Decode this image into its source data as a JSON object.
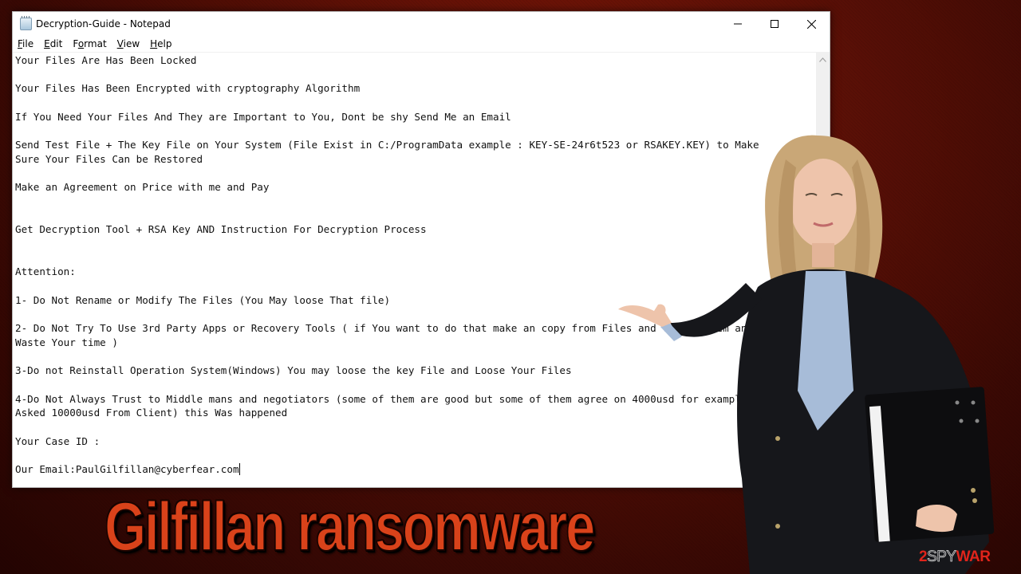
{
  "window": {
    "title": "Decryption-Guide - Notepad",
    "app_icon": "notepad-icon",
    "controls": {
      "minimize": "minimize-icon",
      "maximize": "maximize-icon",
      "close": "close-icon"
    }
  },
  "menubar": {
    "items": [
      {
        "label": "File",
        "accel": "F",
        "rest": "ile"
      },
      {
        "label": "Edit",
        "accel": "E",
        "rest": "dit"
      },
      {
        "label": "Format",
        "pre": "F",
        "accel": "o",
        "rest": "rmat"
      },
      {
        "label": "View",
        "accel": "V",
        "rest": "iew"
      },
      {
        "label": "Help",
        "accel": "H",
        "rest": "elp"
      }
    ]
  },
  "editor": {
    "lines": [
      "Your Files Are Has Been Locked",
      "",
      "Your Files Has Been Encrypted with cryptography Algorithm",
      "",
      "If You Need Your Files And They are Important to You, Dont be shy Send Me an Email",
      "",
      "Send Test File + The Key File on Your System (File Exist in C:/ProgramData example : KEY-SE-24r6t523 or RSAKEY.KEY) to Make",
      "Sure Your Files Can be Restored",
      "",
      "Make an Agreement on Price with me and Pay",
      "",
      "",
      "Get Decryption Tool + RSA Key AND Instruction For Decryption Process",
      "",
      "",
      "Attention:",
      "",
      "1- Do Not Rename or Modify The Files (You May loose That file)",
      "",
      "2- Do Not Try To Use 3rd Party Apps or Recovery Tools ( if You want to do that make an copy from Files and Try on them and",
      "Waste Your time )",
      "",
      "3-Do not Reinstall Operation System(Windows) You may loose the key File and Loose Your Files",
      "",
      "4-Do Not Always Trust to Middle mans and negotiators (some of them are good but some of them agree on 4000usd for example and",
      "Asked 10000usd From Client) this Was happened",
      "",
      "Your Case ID :",
      "",
      "Our Email:PaulGilfillan@cyberfear.com"
    ],
    "scrollbar_up": "chevron-up-icon"
  },
  "headline": "Gilfillan ransomware",
  "watermark": {
    "part1": "2",
    "part2": "SPY",
    "part3": "WAR"
  },
  "colors": {
    "headline": "#d9421a",
    "background": "#5c1006",
    "watermark_red": "#e0241b"
  }
}
